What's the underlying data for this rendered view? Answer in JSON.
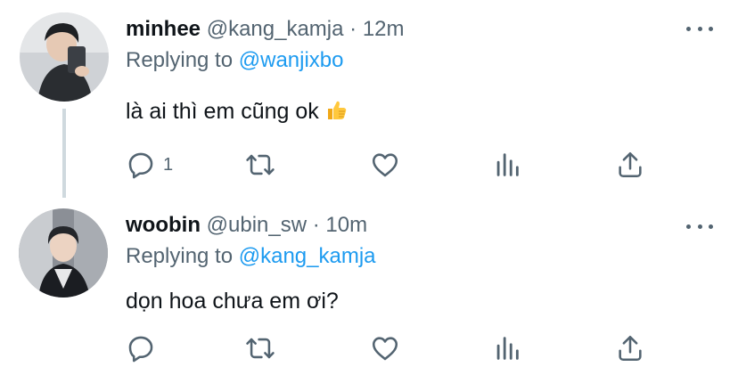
{
  "tweets": [
    {
      "display_name": "minhee",
      "handle": "@kang_kamja",
      "dot": "·",
      "time": "12m",
      "replying_prefix": "Replying to",
      "replying_to": "@wanjixbo",
      "text": "là ai thì em cũng ok",
      "emoji": "thumbs-up",
      "reply_count": "1"
    },
    {
      "display_name": "woobin",
      "handle": "@ubin_sw",
      "dot": "·",
      "time": "10m",
      "replying_prefix": "Replying to",
      "replying_to": "@kang_kamja",
      "text": "dọn hoa chưa em ơi?",
      "reply_count": ""
    }
  ],
  "colors": {
    "text": "#0f1419",
    "secondary": "#536471",
    "link": "#1d9bf0",
    "thread_line": "#cfd9de"
  },
  "icons": [
    "reply-icon",
    "retweet-icon",
    "like-icon",
    "stats-icon",
    "share-icon",
    "more-icon"
  ]
}
